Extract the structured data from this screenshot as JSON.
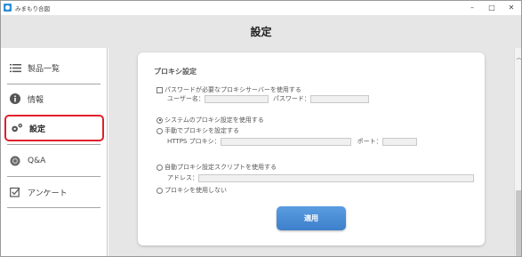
{
  "window": {
    "title": "みまもり合図",
    "controls": {
      "minimize": "–",
      "maximize": "□",
      "close": "✕"
    }
  },
  "header": {
    "title": "設定"
  },
  "sidebar": {
    "items": [
      {
        "label": "製品一覧",
        "icon": "list-icon"
      },
      {
        "label": "情報",
        "icon": "info-icon"
      },
      {
        "label": "設定",
        "icon": "gears-icon",
        "active": true
      },
      {
        "label": "Q&A",
        "icon": "question-icon"
      },
      {
        "label": "アンケート",
        "icon": "checkbox-icon"
      }
    ],
    "active_color": "#e0202c"
  },
  "proxy": {
    "title": "プロキシ設定",
    "auth_checkbox_label": "パスワードが必要なプロキシサーバーを使用する",
    "auth_checked": false,
    "username_label": "ユーザー名：",
    "username_value": "",
    "password_label": "パスワード：",
    "password_value": "",
    "options": [
      {
        "label": "システムのプロキシ設定を使用する",
        "selected": true
      },
      {
        "label": "手動でプロキシを設定する",
        "selected": false
      },
      {
        "label": "自動プロキシ設定スクリプトを使用する",
        "selected": false
      },
      {
        "label": "プロキシを使用しない",
        "selected": false
      }
    ],
    "https_proxy_label": "HTTPS プロキシ：",
    "https_proxy_value": "",
    "port_label": "ポート：",
    "port_value": "",
    "address_label": "アドレス：",
    "address_value": ""
  },
  "apply_button": {
    "label": "適用",
    "color": "#4a8ed6"
  }
}
